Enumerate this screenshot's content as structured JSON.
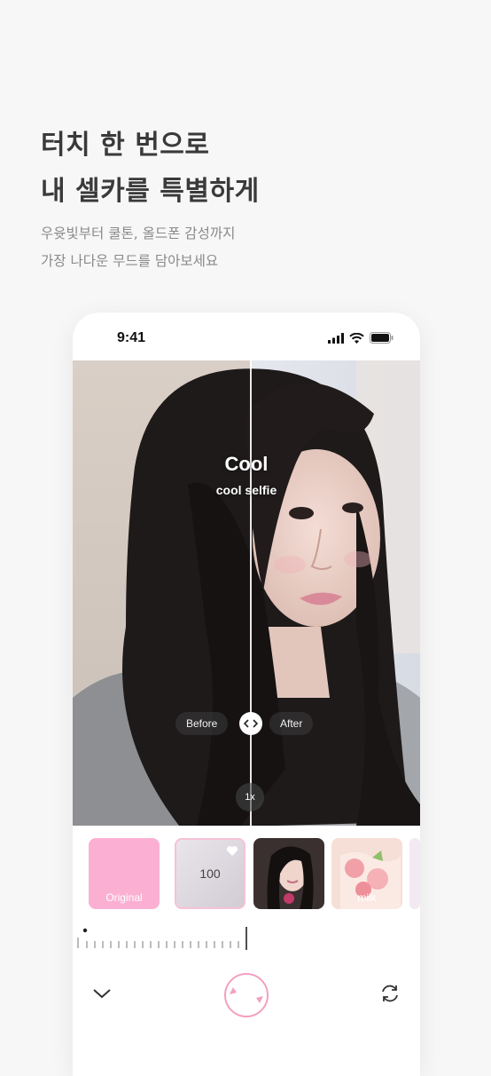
{
  "promo": {
    "headline_line1": "터치 한 번으로",
    "headline_line2": "내 셀카를 특별하게",
    "subline_line1": "우윳빛부터 쿨톤, 올드폰 감성까지",
    "subline_line2": "가장 나다운 무드를 담아보세요"
  },
  "status_bar": {
    "time": "9:41",
    "icons": [
      "cellular-signal-icon",
      "wifi-icon",
      "battery-icon"
    ]
  },
  "preview": {
    "filter_name": "Cool",
    "filter_caption": "cool selfie",
    "before_label": "Before",
    "after_label": "After",
    "zoom_label": "1x"
  },
  "filters": [
    {
      "label": "Original",
      "color": "#fbb0d3"
    },
    {
      "value": "100",
      "selected": true,
      "icon": "heart-icon"
    },
    {
      "label": "",
      "icon": "portrait-thumbnail"
    },
    {
      "label": "milk",
      "icon": "strawberry-thumbnail"
    }
  ],
  "bottom_controls": {
    "left_icon": "chevron-down-icon",
    "center": "shutter-button",
    "right_icon": "flip-camera-icon"
  },
  "colors": {
    "accent_pink": "#f3a0c0",
    "original_swatch": "#fbb0d3"
  }
}
